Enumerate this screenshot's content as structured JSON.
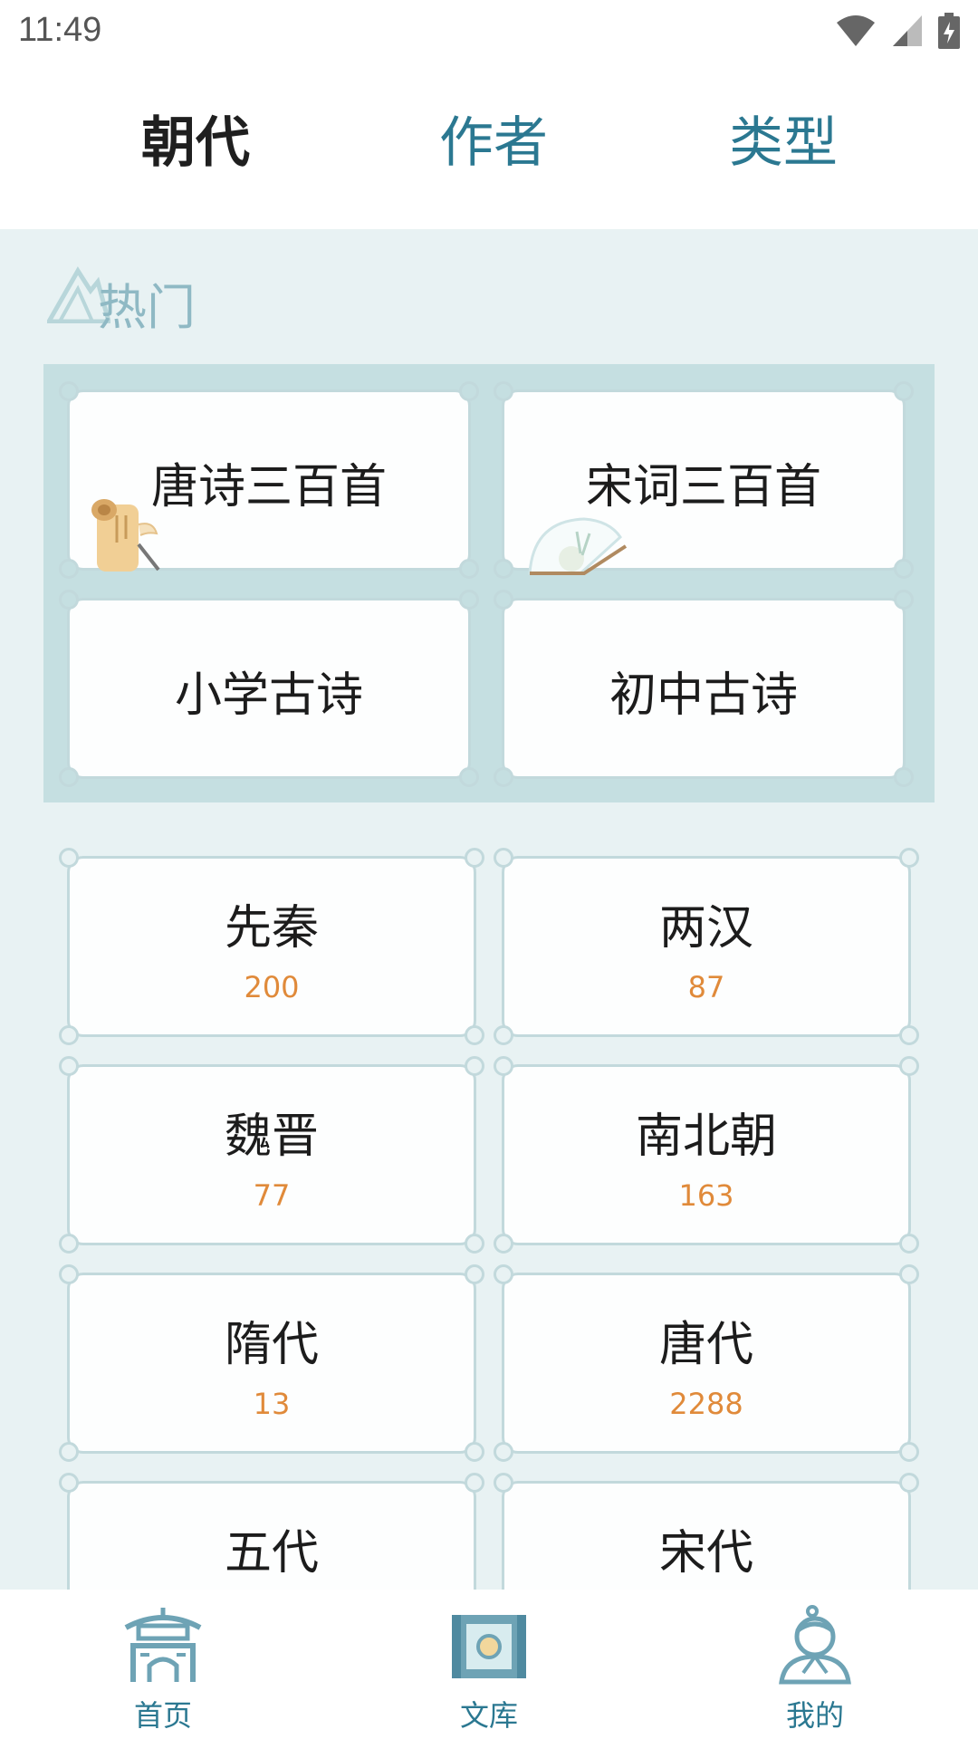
{
  "status": {
    "time": "11:49"
  },
  "tabs": [
    {
      "label": "朝代",
      "active": true
    },
    {
      "label": "作者",
      "active": false
    },
    {
      "label": "类型",
      "active": false
    }
  ],
  "hot": {
    "title": "热门",
    "items": [
      {
        "label": "唐诗三百首",
        "icon": "scroll-icon"
      },
      {
        "label": "宋词三百首",
        "icon": "fan-icon"
      },
      {
        "label": "小学古诗"
      },
      {
        "label": "初中古诗"
      }
    ]
  },
  "dynasties": [
    {
      "name": "先秦",
      "count": "200"
    },
    {
      "name": "两汉",
      "count": "87"
    },
    {
      "name": "魏晋",
      "count": "77"
    },
    {
      "name": "南北朝",
      "count": "163"
    },
    {
      "name": "隋代",
      "count": "13"
    },
    {
      "name": "唐代",
      "count": "2288"
    },
    {
      "name": "五代",
      "count": ""
    },
    {
      "name": "宋代",
      "count": ""
    }
  ],
  "nav": [
    {
      "label": "首页",
      "icon": "gate-icon"
    },
    {
      "label": "文库",
      "icon": "scroll-library-icon"
    },
    {
      "label": "我的",
      "icon": "scholar-icon"
    }
  ],
  "colors": {
    "accent": "#2b7891",
    "count": "#e08a3a",
    "panel": "#c5dfe1",
    "background": "#e8f2f3"
  }
}
